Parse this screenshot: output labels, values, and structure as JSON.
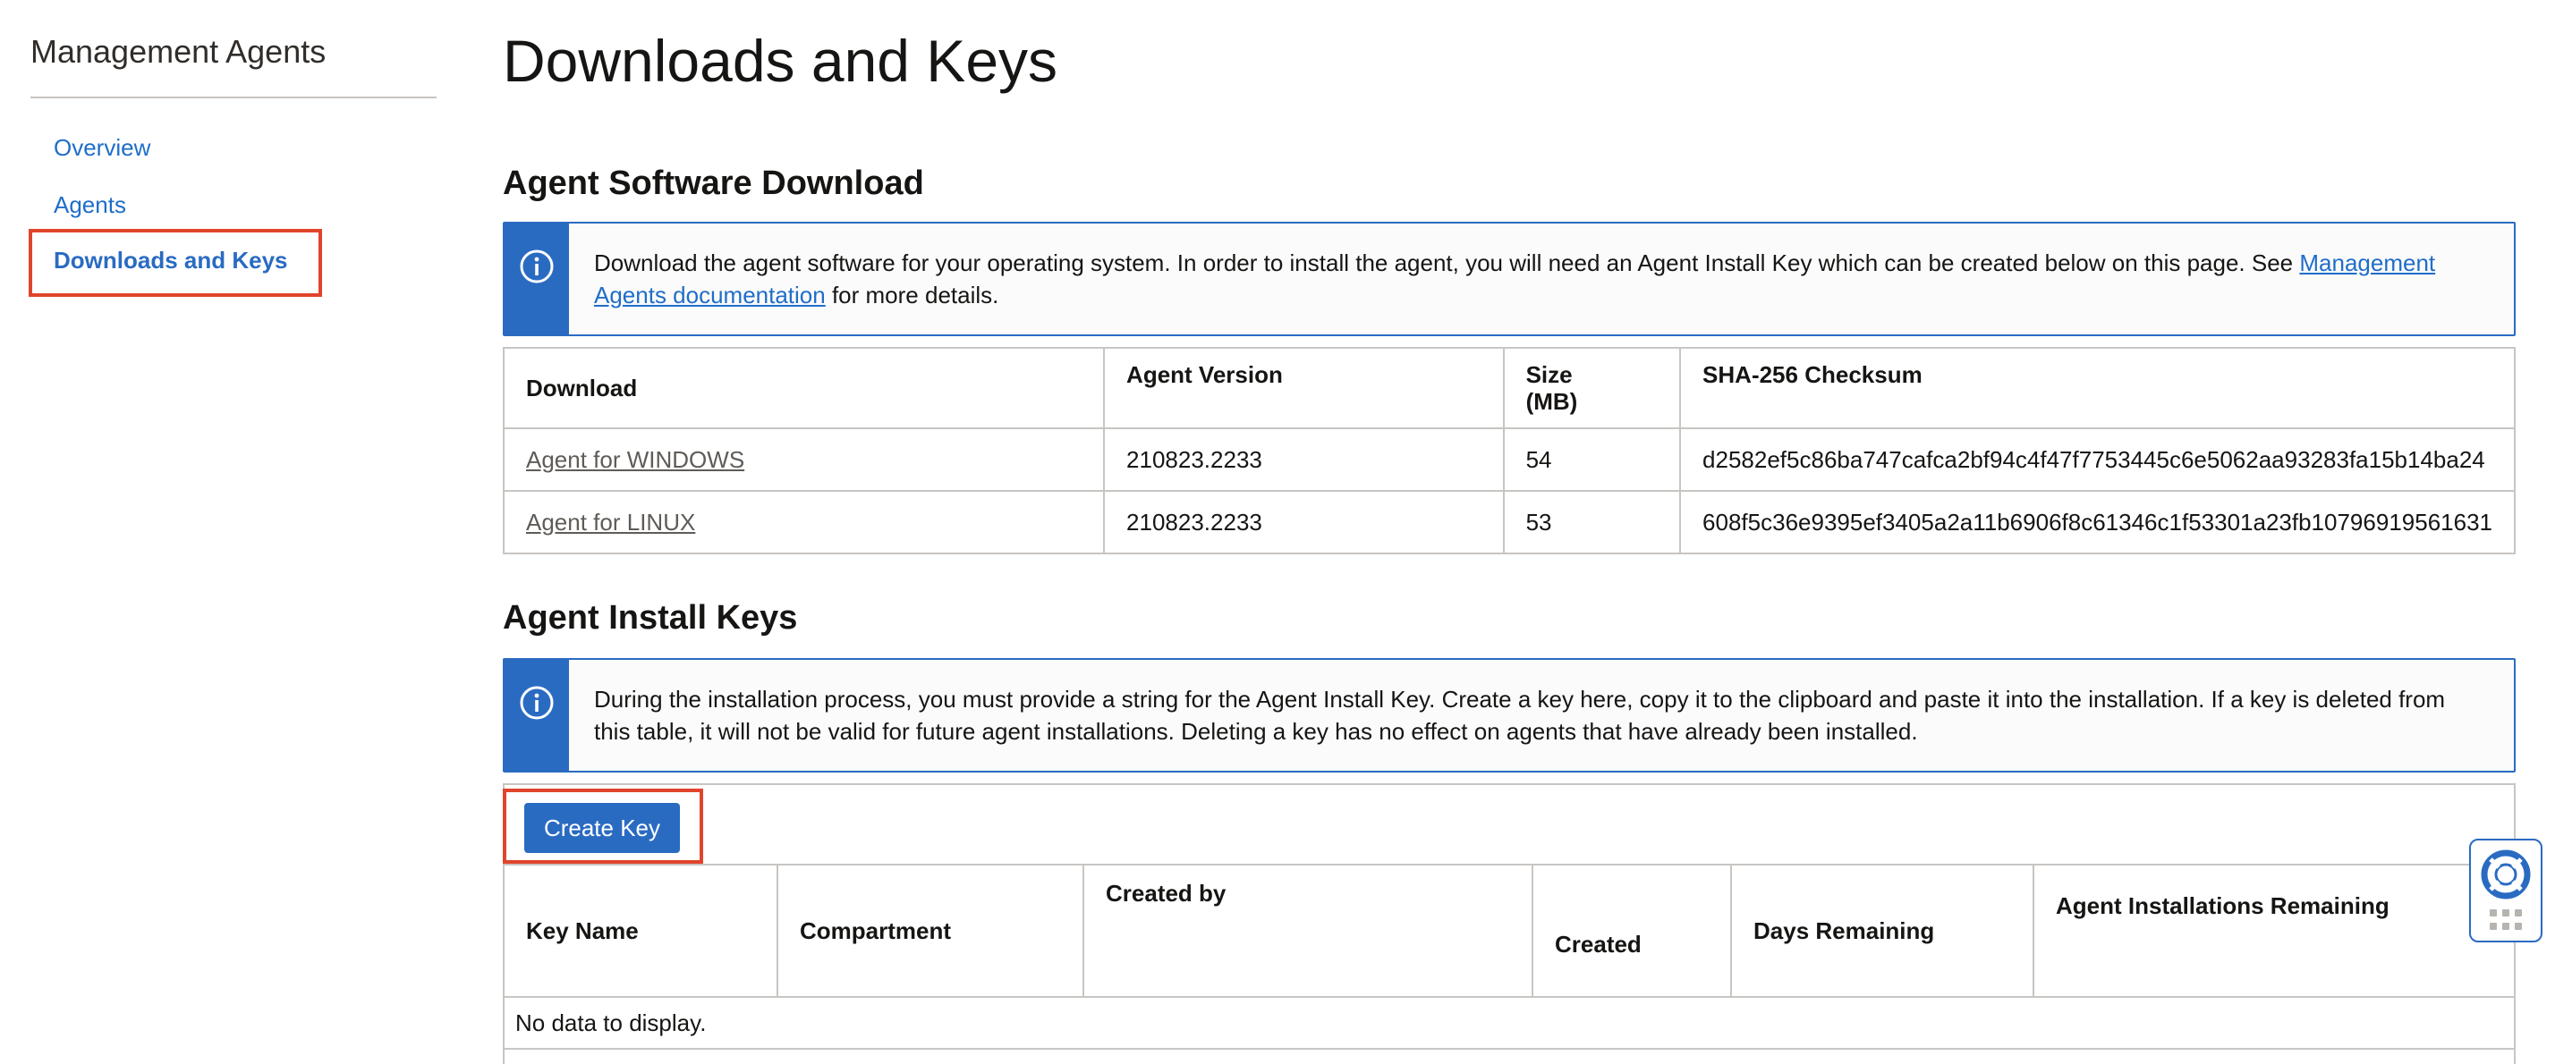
{
  "sidebar": {
    "title": "Management Agents",
    "items": [
      {
        "label": "Overview"
      },
      {
        "label": "Agents"
      },
      {
        "label": "Downloads and Keys"
      }
    ]
  },
  "page": {
    "title": "Downloads and Keys"
  },
  "software": {
    "heading": "Agent Software Download",
    "info_text": "Download the agent software for your operating system. In order to install the agent, you will need an Agent Install Key which can be created below on this page. See ",
    "info_link": "Management Agents documentation",
    "info_suffix": " for more details.",
    "columns": {
      "download": "Download",
      "version": "Agent Version",
      "size_line1": "Size",
      "size_line2": "(MB)",
      "checksum": "SHA-256 Checksum"
    },
    "rows": [
      {
        "download": "Agent for WINDOWS",
        "version": "210823.2233",
        "size": "54",
        "checksum": "d2582ef5c86ba747cafca2bf94c4f47f7753445c6e5062aa93283fa15b14ba24"
      },
      {
        "download": "Agent for LINUX",
        "version": "210823.2233",
        "size": "53",
        "checksum": "608f5c36e9395ef3405a2a11b6906f8c61346c1f53301a23fb10796919561631"
      }
    ]
  },
  "keys": {
    "heading": "Agent Install Keys",
    "info_text": "During the installation process, you must provide a string for the Agent Install Key. Create a key here, copy it to the clipboard and paste it into the installation. If a key is deleted from this table, it will not be valid for future agent installations. Deleting a key has no effect on agents that have already been installed.",
    "create_button": "Create Key",
    "columns": {
      "key_name": "Key Name",
      "compartment": "Compartment",
      "created_by": "Created by",
      "created": "Created",
      "days_remaining": "Days Remaining",
      "installs_remaining": "Agent Installations Remaining"
    },
    "empty_text": "No data to display."
  },
  "colors": {
    "accent": "#2a6bc2",
    "link": "#1f6dc9",
    "highlight": "#e0442c",
    "border": "#c8c5c2"
  },
  "icons": {
    "info": "info-icon",
    "help": "lifebuoy-icon",
    "grid": "grid-dots-icon"
  }
}
